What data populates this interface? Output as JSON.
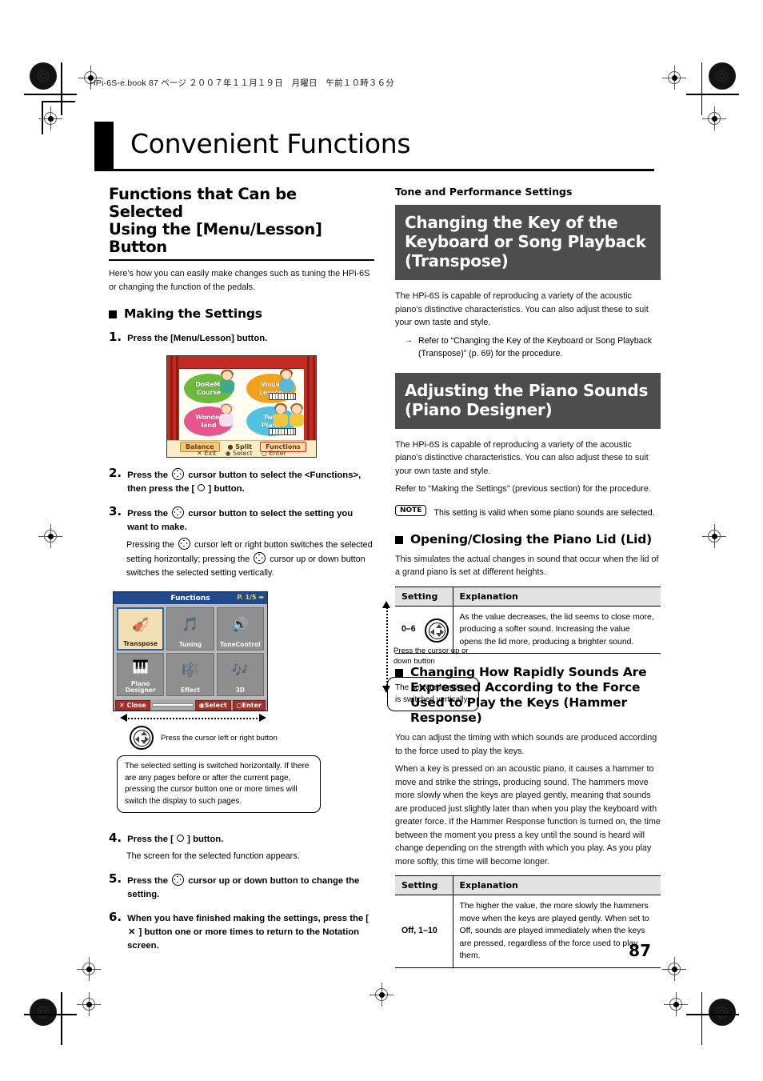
{
  "header": {
    "file_line": "HPi-6S-e.book  87 ページ  ２００７年１１月１９日　月曜日　午前１０時３６分"
  },
  "chapter": {
    "title": "Convenient Functions"
  },
  "page_number": "87",
  "left_column": {
    "section_title_line1": "Functions that Can be Selected",
    "section_title_line2": "Using the [Menu/Lesson] Button",
    "intro": "Here’s how you can easily make changes such as tuning the HPi-6S or changing the function of the pedals.",
    "subhead": "Making the Settings",
    "steps": [
      {
        "num": "1.",
        "text": "Press the [Menu/Lesson] button."
      },
      {
        "num": "2.",
        "text_a": "Press the ",
        "text_b": " cursor button to select the <Functions>, then press the [ ",
        "text_c": " ] button."
      },
      {
        "num": "3.",
        "text_a": "Press the ",
        "text_b": " cursor button to select the setting you want to make."
      },
      {
        "num": "4.",
        "text": "Press the [ ",
        "text_tail": " ] button."
      },
      {
        "num": "5.",
        "text_a": "Press the ",
        "text_b": " cursor up or down button to change the setting."
      },
      {
        "num": "6.",
        "text_a": "When you have finished making the settings, press the [ ",
        "text_b": " ] button one or more times to return to the Notation screen."
      }
    ],
    "step3_note_a": "Pressing the ",
    "step3_note_b": " cursor left or right button switches the selected setting horizontally; pressing the ",
    "step3_note_c": " cursor up or down button switches the selected setting vertically.",
    "step4_note": "The screen for the selected function appears.",
    "menu_screen": {
      "bubbles": [
        {
          "label_line1": "DoReMi",
          "label_line2": "Course"
        },
        {
          "label_line1": "Visual",
          "label_line2": "Lesson"
        },
        {
          "label_line1": "Wonder",
          "label_line2": "land"
        },
        {
          "label_line1": "Twin",
          "label_line2": "Piano"
        }
      ],
      "buttons": [
        "Balance",
        "Split",
        "Functions"
      ],
      "hints": [
        "Exit",
        "Select",
        "Enter"
      ]
    },
    "functions_screen": {
      "title": "Functions",
      "page_indicator": "P. 1/5",
      "cells": [
        {
          "label": "Transpose",
          "icon": "book-strings-icon",
          "active": true
        },
        {
          "label": "Tuning",
          "icon": "tuning-fork-icon",
          "active": false
        },
        {
          "label": "ToneControl",
          "icon": "speaker-tone-icon",
          "active": false
        },
        {
          "label1": "Piano",
          "label2": "Designer",
          "icon": "piano-pencil-icon",
          "active": false
        },
        {
          "label": "Effect",
          "icon": "effect-piano-icon",
          "active": false
        },
        {
          "label": "3D",
          "icon": "3d-piano-icon",
          "active": false
        }
      ],
      "status": {
        "close": "Close",
        "select": "Select",
        "enter": "Enter"
      }
    },
    "callouts": {
      "vertical_caption": "Press the cursor up or down button",
      "vertical_box": "The selected setting is switched vertically.",
      "horizontal_caption": "Press the cursor left or right button",
      "horizontal_box": "The selected setting is switched horizontally. If there are any pages before or after the current page, pressing the cursor button one or more times will switch the display to such pages."
    }
  },
  "right_column": {
    "subsection": "Tone and Performance Settings",
    "banner1": "Changing the Key of the Keyboard or Song Playback (Transpose)",
    "body1": "The HPi-6S is capable of reproducing a variety of the acoustic piano’s distinctive characteristics. You can also adjust these to suit your own taste and style.",
    "arrow1": "Refer to “Changing the Key of the Keyboard or Song Playback (Transpose)” (p. 69) for the procedure.",
    "banner2": "Adjusting the Piano Sounds (Piano Designer)",
    "body2": "The HPi-6S is capable of reproducing a variety of the acoustic piano’s distinctive characteristics. You can also adjust these to suit your own taste and style.",
    "body3": "Refer to “Making the Settings” (previous section) for the procedure.",
    "note_badge": "NOTE",
    "note_text": "This setting is valid when some piano sounds are selected.",
    "lid_heading": "Opening/Closing the Piano Lid (Lid)",
    "lid_body": "This simulates the actual changes in sound that occur when the lid of a grand piano is set at different heights.",
    "table_lid": {
      "headers": [
        "Setting",
        "Explanation"
      ],
      "rows": [
        {
          "setting": "0–6",
          "explanation": "As the value decreases, the lid seems to close more, producing a softer sound. Increasing the value opens the lid more, producing a brighter sound."
        }
      ]
    },
    "hammer_heading": "Changing How Rapidly Sounds Are Expressed According to the Force Used to Play the Keys (Hammer Response)",
    "hammer_body1": "You can adjust the timing with which sounds are produced according to the force used to play the keys.",
    "hammer_body2": "When a key is pressed on an acoustic piano, it causes a hammer to move and strike the strings, producing sound. The hammers move more slowly when the keys are played gently, meaning that sounds are produced just slightly later than when you play the keyboard with greater force. If the Hammer Response function is turned on, the time between the moment you press a key until the sound is heard will change depending on the strength with which you play. As you play more softly, this time will become longer.",
    "table_hammer": {
      "headers": [
        "Setting",
        "Explanation"
      ],
      "rows": [
        {
          "setting": "Off, 1–10",
          "explanation": "The higher the value, the more slowly the hammers move when the keys are played gently. When set to Off, sounds are played immediately when the keys are pressed, regardless of the force used to play them."
        }
      ]
    }
  },
  "colors": {
    "banner_bg": "#4d4d4d",
    "lcd_title_bg": "#214a8c",
    "lcd_status_red": "#a4302a",
    "accent_curtain": "#c32b22"
  }
}
